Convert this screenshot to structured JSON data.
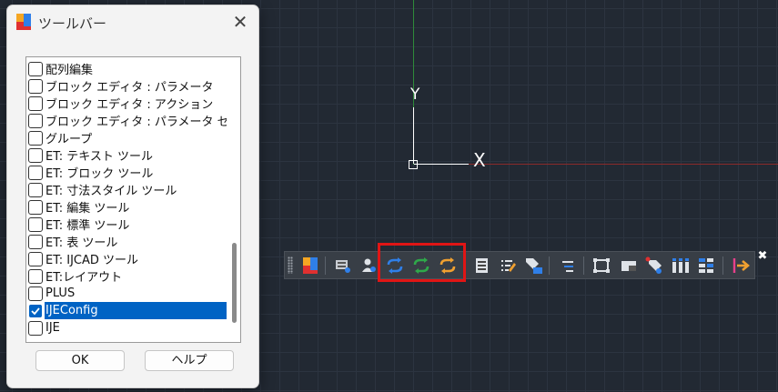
{
  "dialog": {
    "title": "ツールバー",
    "close_glyph": "✕",
    "ok_label": "OK",
    "help_label": "ヘルプ",
    "items": [
      {
        "label": "配列編集",
        "checked": false
      },
      {
        "label": "ブロック エディタ : パラメータ",
        "checked": false
      },
      {
        "label": "ブロック エディタ : アクション",
        "checked": false
      },
      {
        "label": "ブロック エディタ : パラメータ セ",
        "checked": false
      },
      {
        "label": "グループ",
        "checked": false
      },
      {
        "label": "ET: テキスト ツール",
        "checked": false
      },
      {
        "label": "ET: ブロック ツール",
        "checked": false
      },
      {
        "label": "ET: 寸法スタイル ツール",
        "checked": false
      },
      {
        "label": "ET: 編集 ツール",
        "checked": false
      },
      {
        "label": "ET: 標準 ツール",
        "checked": false
      },
      {
        "label": "ET: 表 ツール",
        "checked": false
      },
      {
        "label": "ET: IJCAD ツール",
        "checked": false
      },
      {
        "label": "ET:レイアウト",
        "checked": false
      },
      {
        "label": "PLUS",
        "checked": false
      },
      {
        "label": "IJEConfig",
        "checked": true,
        "selected": true
      },
      {
        "label": "IJE",
        "checked": false
      }
    ]
  },
  "canvas": {
    "y_axis_label": "Y",
    "x_axis_label": "X"
  },
  "toolbar": {
    "close_glyph": "✖",
    "colors": {
      "blue_arrow": "#2f7fe8",
      "green_arrow": "#2fa84a",
      "orange_arrow": "#f0a030",
      "highlight": "#e01515"
    },
    "icons": [
      {
        "name": "ijcad-logo-icon"
      },
      {
        "name": "layer-manager-icon"
      },
      {
        "name": "user-settings-icon"
      },
      {
        "name": "sync-blue-icon"
      },
      {
        "name": "sync-green-icon"
      },
      {
        "name": "sync-orange-icon"
      },
      {
        "name": "document-list-icon"
      },
      {
        "name": "edit-list-icon"
      },
      {
        "name": "tag-properties-icon"
      },
      {
        "name": "filter-lines-icon"
      },
      {
        "name": "frame-select-icon"
      },
      {
        "name": "window-layout-icon"
      },
      {
        "name": "tag-color-icon"
      },
      {
        "name": "column-bars-icon"
      },
      {
        "name": "grid-table-icon"
      },
      {
        "name": "exit-arrow-icon"
      }
    ]
  }
}
